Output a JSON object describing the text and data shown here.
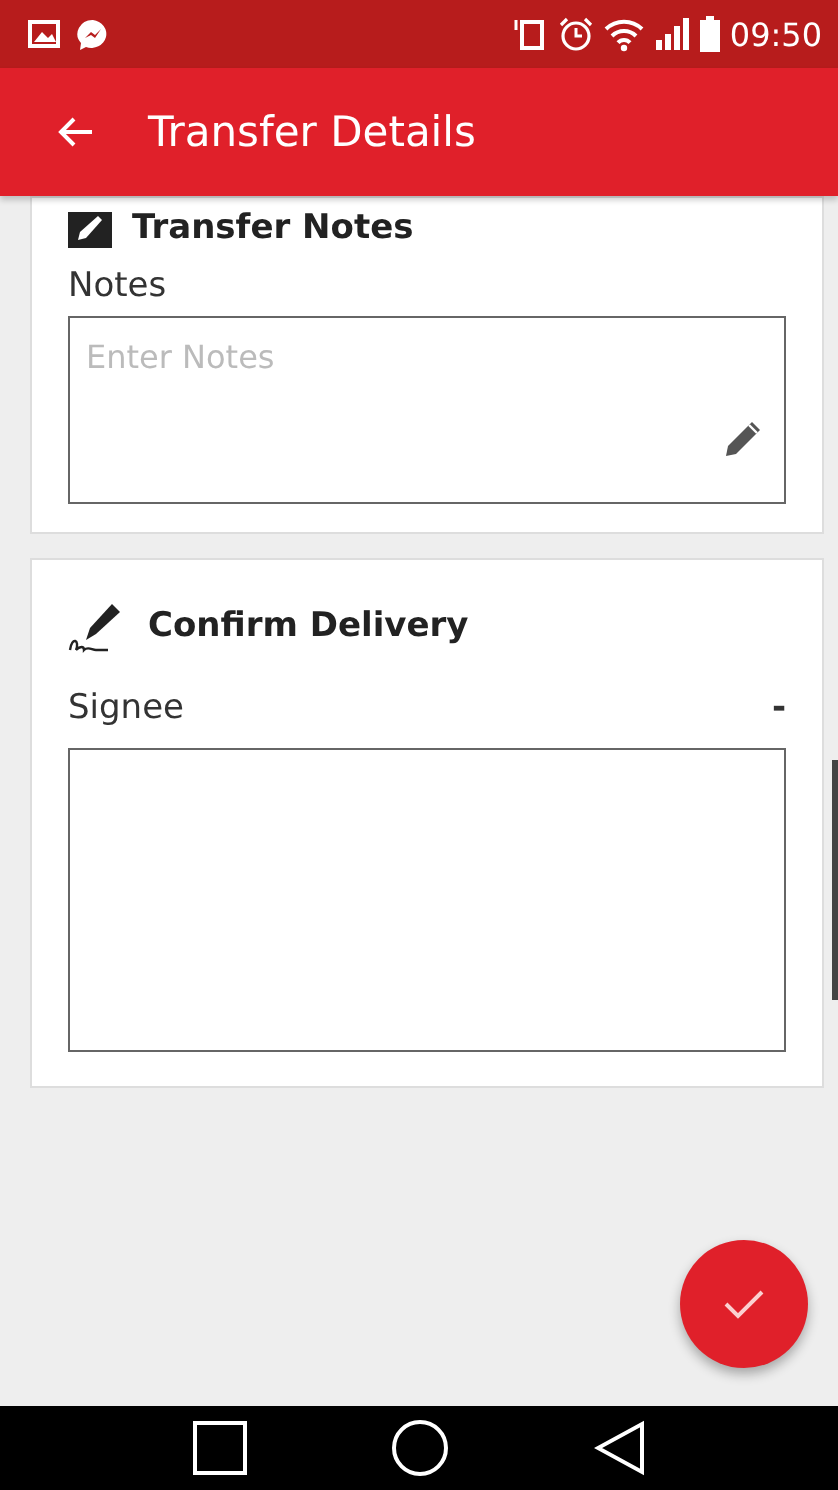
{
  "status_bar": {
    "time": "09:50"
  },
  "app_bar": {
    "title": "Transfer Details"
  },
  "notes_card": {
    "heading": "Transfer Notes",
    "label": "Notes",
    "placeholder": "Enter Notes"
  },
  "delivery_card": {
    "heading": "Confirm Delivery",
    "signee_label": "Signee",
    "signee_value": "-"
  }
}
